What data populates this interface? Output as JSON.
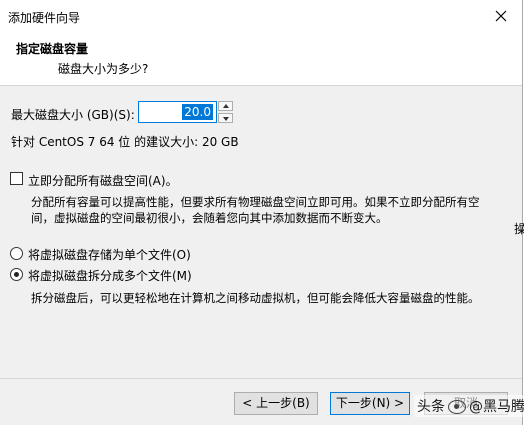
{
  "window": {
    "title": "添加硬件向导"
  },
  "header": {
    "title": "指定磁盘容量",
    "subtitle": "磁盘大小为多少?"
  },
  "disk_size": {
    "label": "最大磁盘大小 (GB)(S):",
    "value": "20.0"
  },
  "recommendation": "针对 CentOS 7 64 位 的建议大小: 20 GB",
  "allocate_all": {
    "label": "立即分配所有磁盘空间(A)。",
    "checked": false,
    "description_line1": "分配所有容量可以提高性能，但要求所有物理磁盘空间立即可用。如果不立即分配所有空",
    "description_line2": "间，虚拟磁盘的空间最初很小，会随着您向其中添加数据而不断变大。"
  },
  "storage_options": [
    {
      "label": "将虚拟磁盘存储为单个文件(O)",
      "selected": false
    },
    {
      "label": "将虚拟磁盘拆分成多个文件(M)",
      "selected": true
    }
  ],
  "split_description": "拆分磁盘后，可以更轻松地在计算机之间移动虚拟机，但可能会降低大容量磁盘的性能。",
  "buttons": {
    "back": "< 上一步(B)",
    "next": "下一步(N) >",
    "cancel": "取消"
  },
  "background_clip": "操",
  "watermark": {
    "prefix": "头条",
    "suffix": "@黑马腾云"
  },
  "colors": {
    "accent": "#0078d7",
    "dialog_bg": "#f0f0f0"
  }
}
